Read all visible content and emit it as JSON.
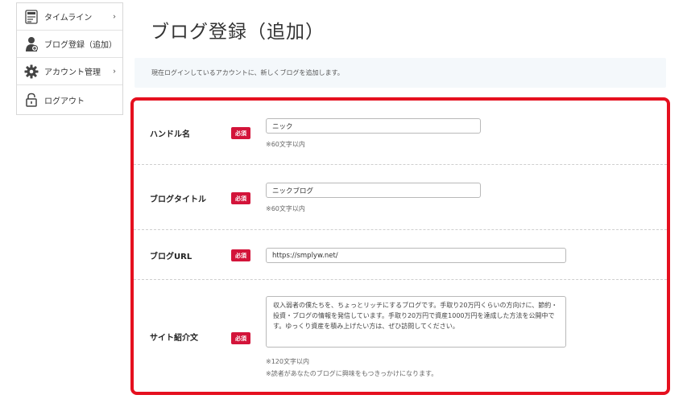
{
  "sidebar": {
    "items": [
      {
        "label": "タイムライン",
        "icon": "timeline-icon",
        "has_arrow": true
      },
      {
        "label": "ブログ登録（追加）",
        "icon": "user-add-icon",
        "has_arrow": false
      },
      {
        "label": "アカウント管理",
        "icon": "gear-icon",
        "has_arrow": true
      },
      {
        "label": "ログアウト",
        "icon": "lock-icon",
        "has_arrow": false
      }
    ],
    "chevron": "›"
  },
  "page": {
    "title": "ブログ登録（追加）",
    "info": "現在ログインしているアカウントに、新しくブログを追加します。"
  },
  "form": {
    "required_badge": "必須",
    "highlight_color": "#e5101f",
    "badge_color": "#d3143a",
    "handle": {
      "label": "ハンドル名",
      "value": "ニック",
      "note": "※60文字以内"
    },
    "blog_title": {
      "label": "ブログタイトル",
      "value": "ニックブログ",
      "note": "※60文字以内"
    },
    "blog_url": {
      "label": "ブログURL",
      "value": "https://smplyw.net/"
    },
    "site_intro": {
      "label": "サイト紹介文",
      "value": "収入弱者の僕たちを、ちょっとリッチにするブログです。手取り20万円くらいの方向けに、節約・投資・ブログの情報を発信しています。手取り20万円で資産1000万円を達成した方法を公開中です。ゆっくり資産を積み上げたい方は、ぜひ訪問してください。",
      "note1": "※120文字以内",
      "note2": "※読者があなたのブログに興味をもつきっかけになります。"
    }
  }
}
